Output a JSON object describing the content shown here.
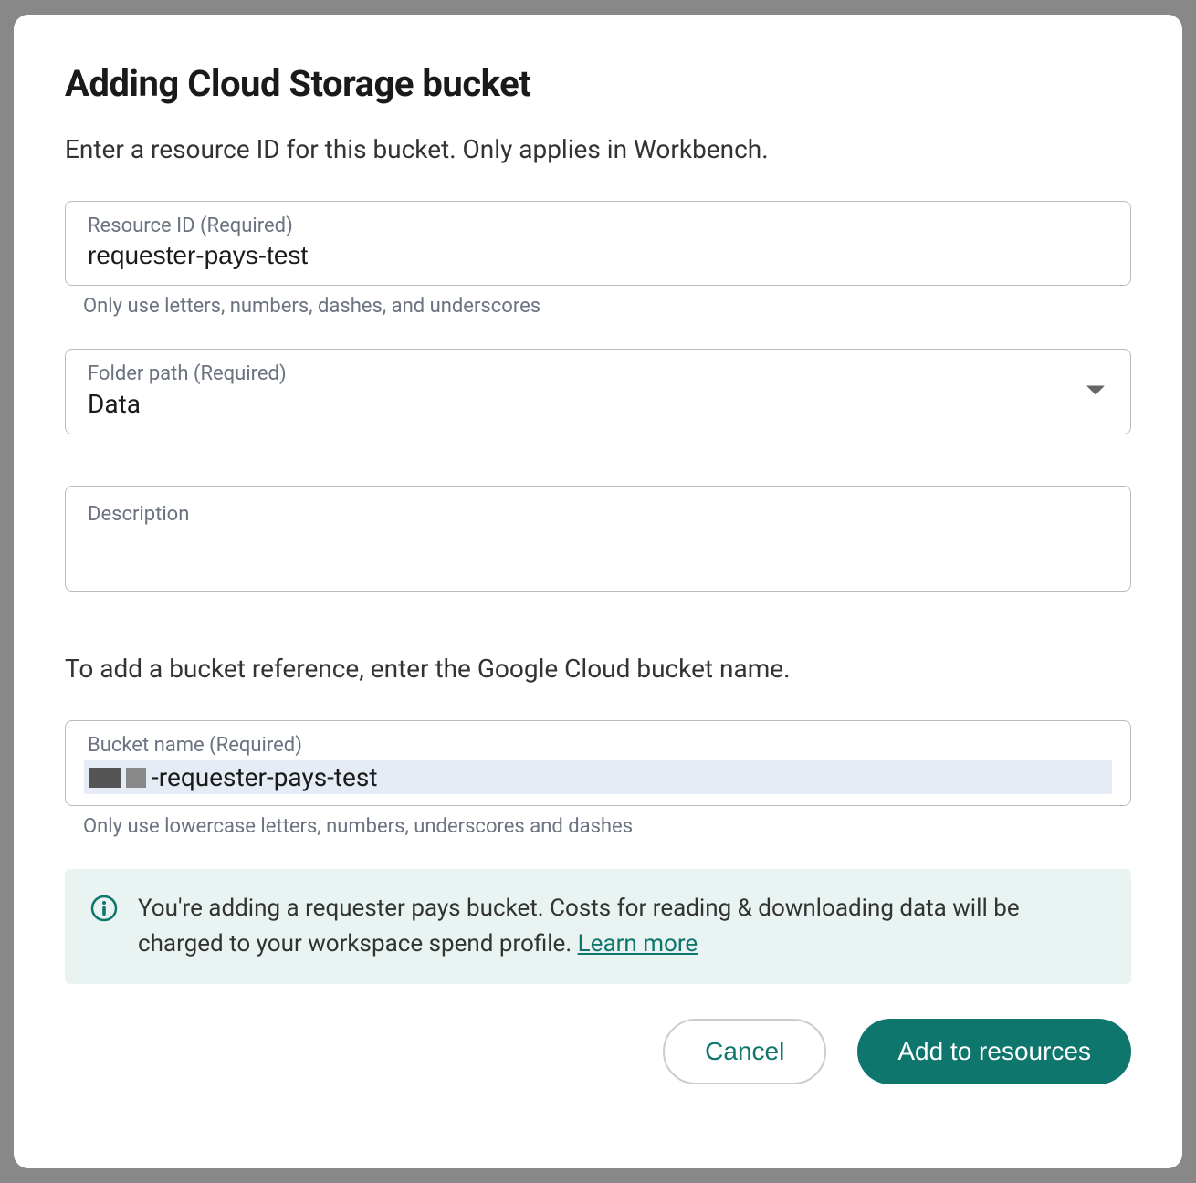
{
  "modal": {
    "title": "Adding Cloud Storage bucket",
    "subtitle": "Enter a resource ID for this bucket. Only applies in Workbench."
  },
  "resource_id": {
    "label": "Resource ID (Required)",
    "value": "requester-pays-test",
    "helper": "Only use letters, numbers, dashes, and underscores"
  },
  "folder_path": {
    "label": "Folder path (Required)",
    "value": "Data"
  },
  "description": {
    "label": "Description",
    "value": ""
  },
  "bucket_section": {
    "intro": "To add a bucket reference, enter the Google Cloud bucket name.",
    "label": "Bucket name (Required)",
    "suffix": "-requester-pays-test",
    "helper": "Only use lowercase letters, numbers, underscores and dashes"
  },
  "info_banner": {
    "text": "You're adding a requester pays bucket. Costs for reading & downloading data will be charged to your workspace spend profile. ",
    "link_text": "Learn more"
  },
  "buttons": {
    "cancel": "Cancel",
    "submit": "Add to resources"
  },
  "colors": {
    "accent": "#0f766e",
    "banner_bg": "#e9f4f2"
  }
}
